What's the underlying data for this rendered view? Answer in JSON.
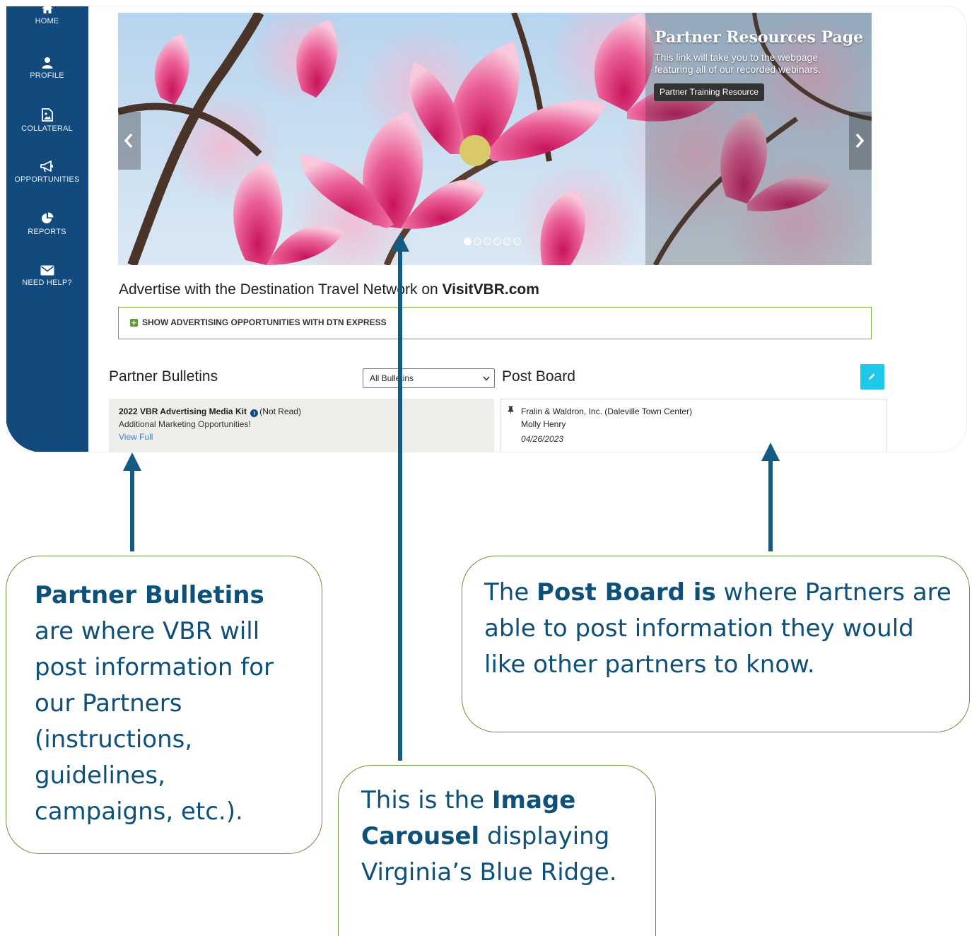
{
  "sidebar": {
    "items": [
      {
        "label": "HOME",
        "icon": "home-icon"
      },
      {
        "label": "PROFILE",
        "icon": "user-icon"
      },
      {
        "label": "COLLATERAL",
        "icon": "image-file-icon"
      },
      {
        "label": "OPPORTUNITIES",
        "icon": "megaphone-icon"
      },
      {
        "label": "REPORTS",
        "icon": "pie-chart-icon"
      },
      {
        "label": "NEED HELP?",
        "icon": "envelope-icon"
      }
    ]
  },
  "carousel": {
    "caption_title": "Partner Resources Page",
    "caption_text": "This link will take you to the webpage featuring all of our recorded webinars.",
    "button_label": "Partner Training Resource",
    "slide_count": 6,
    "active_slide": 1
  },
  "advertise": {
    "heading_prefix": "Advertise with the Destination Travel Network on ",
    "heading_brand": "VisitVBR.com",
    "toggle_label": "SHOW ADVERTISING OPPORTUNITIES WITH DTN EXPRESS"
  },
  "bulletins": {
    "title": "Partner Bulletins",
    "filter_selected": "All Bulletins",
    "items": [
      {
        "title": "2022 VBR Advertising Media Kit",
        "status": "(Not Read)",
        "summary": "Additional Marketing Opportunities!",
        "link": "View Full"
      }
    ]
  },
  "post_board": {
    "title": "Post Board",
    "items": [
      {
        "org": "Fralin & Waldron, Inc. (Daleville Town Center)",
        "author": "Molly Henry",
        "date": "04/26/2023"
      }
    ]
  },
  "callouts": {
    "bulletins": {
      "bold": "Partner Bulletins",
      "text": " are where VBR will post information for our Partners (instructions, guidelines, campaigns, etc.)."
    },
    "post_board": {
      "prefix": "The ",
      "bold": "Post Board is",
      "text": " where Partners are able to post information they would like other partners to know."
    },
    "carousel": {
      "prefix": "This is the ",
      "bold": "Image Carousel",
      "text": " displaying Virginia’s Blue Ridge."
    }
  },
  "colors": {
    "sidebar": "#134a7d",
    "accent_green": "#7aa345",
    "edit_button": "#1ec8e8",
    "arrow": "#135b83",
    "callout_text": "#0f5078"
  }
}
